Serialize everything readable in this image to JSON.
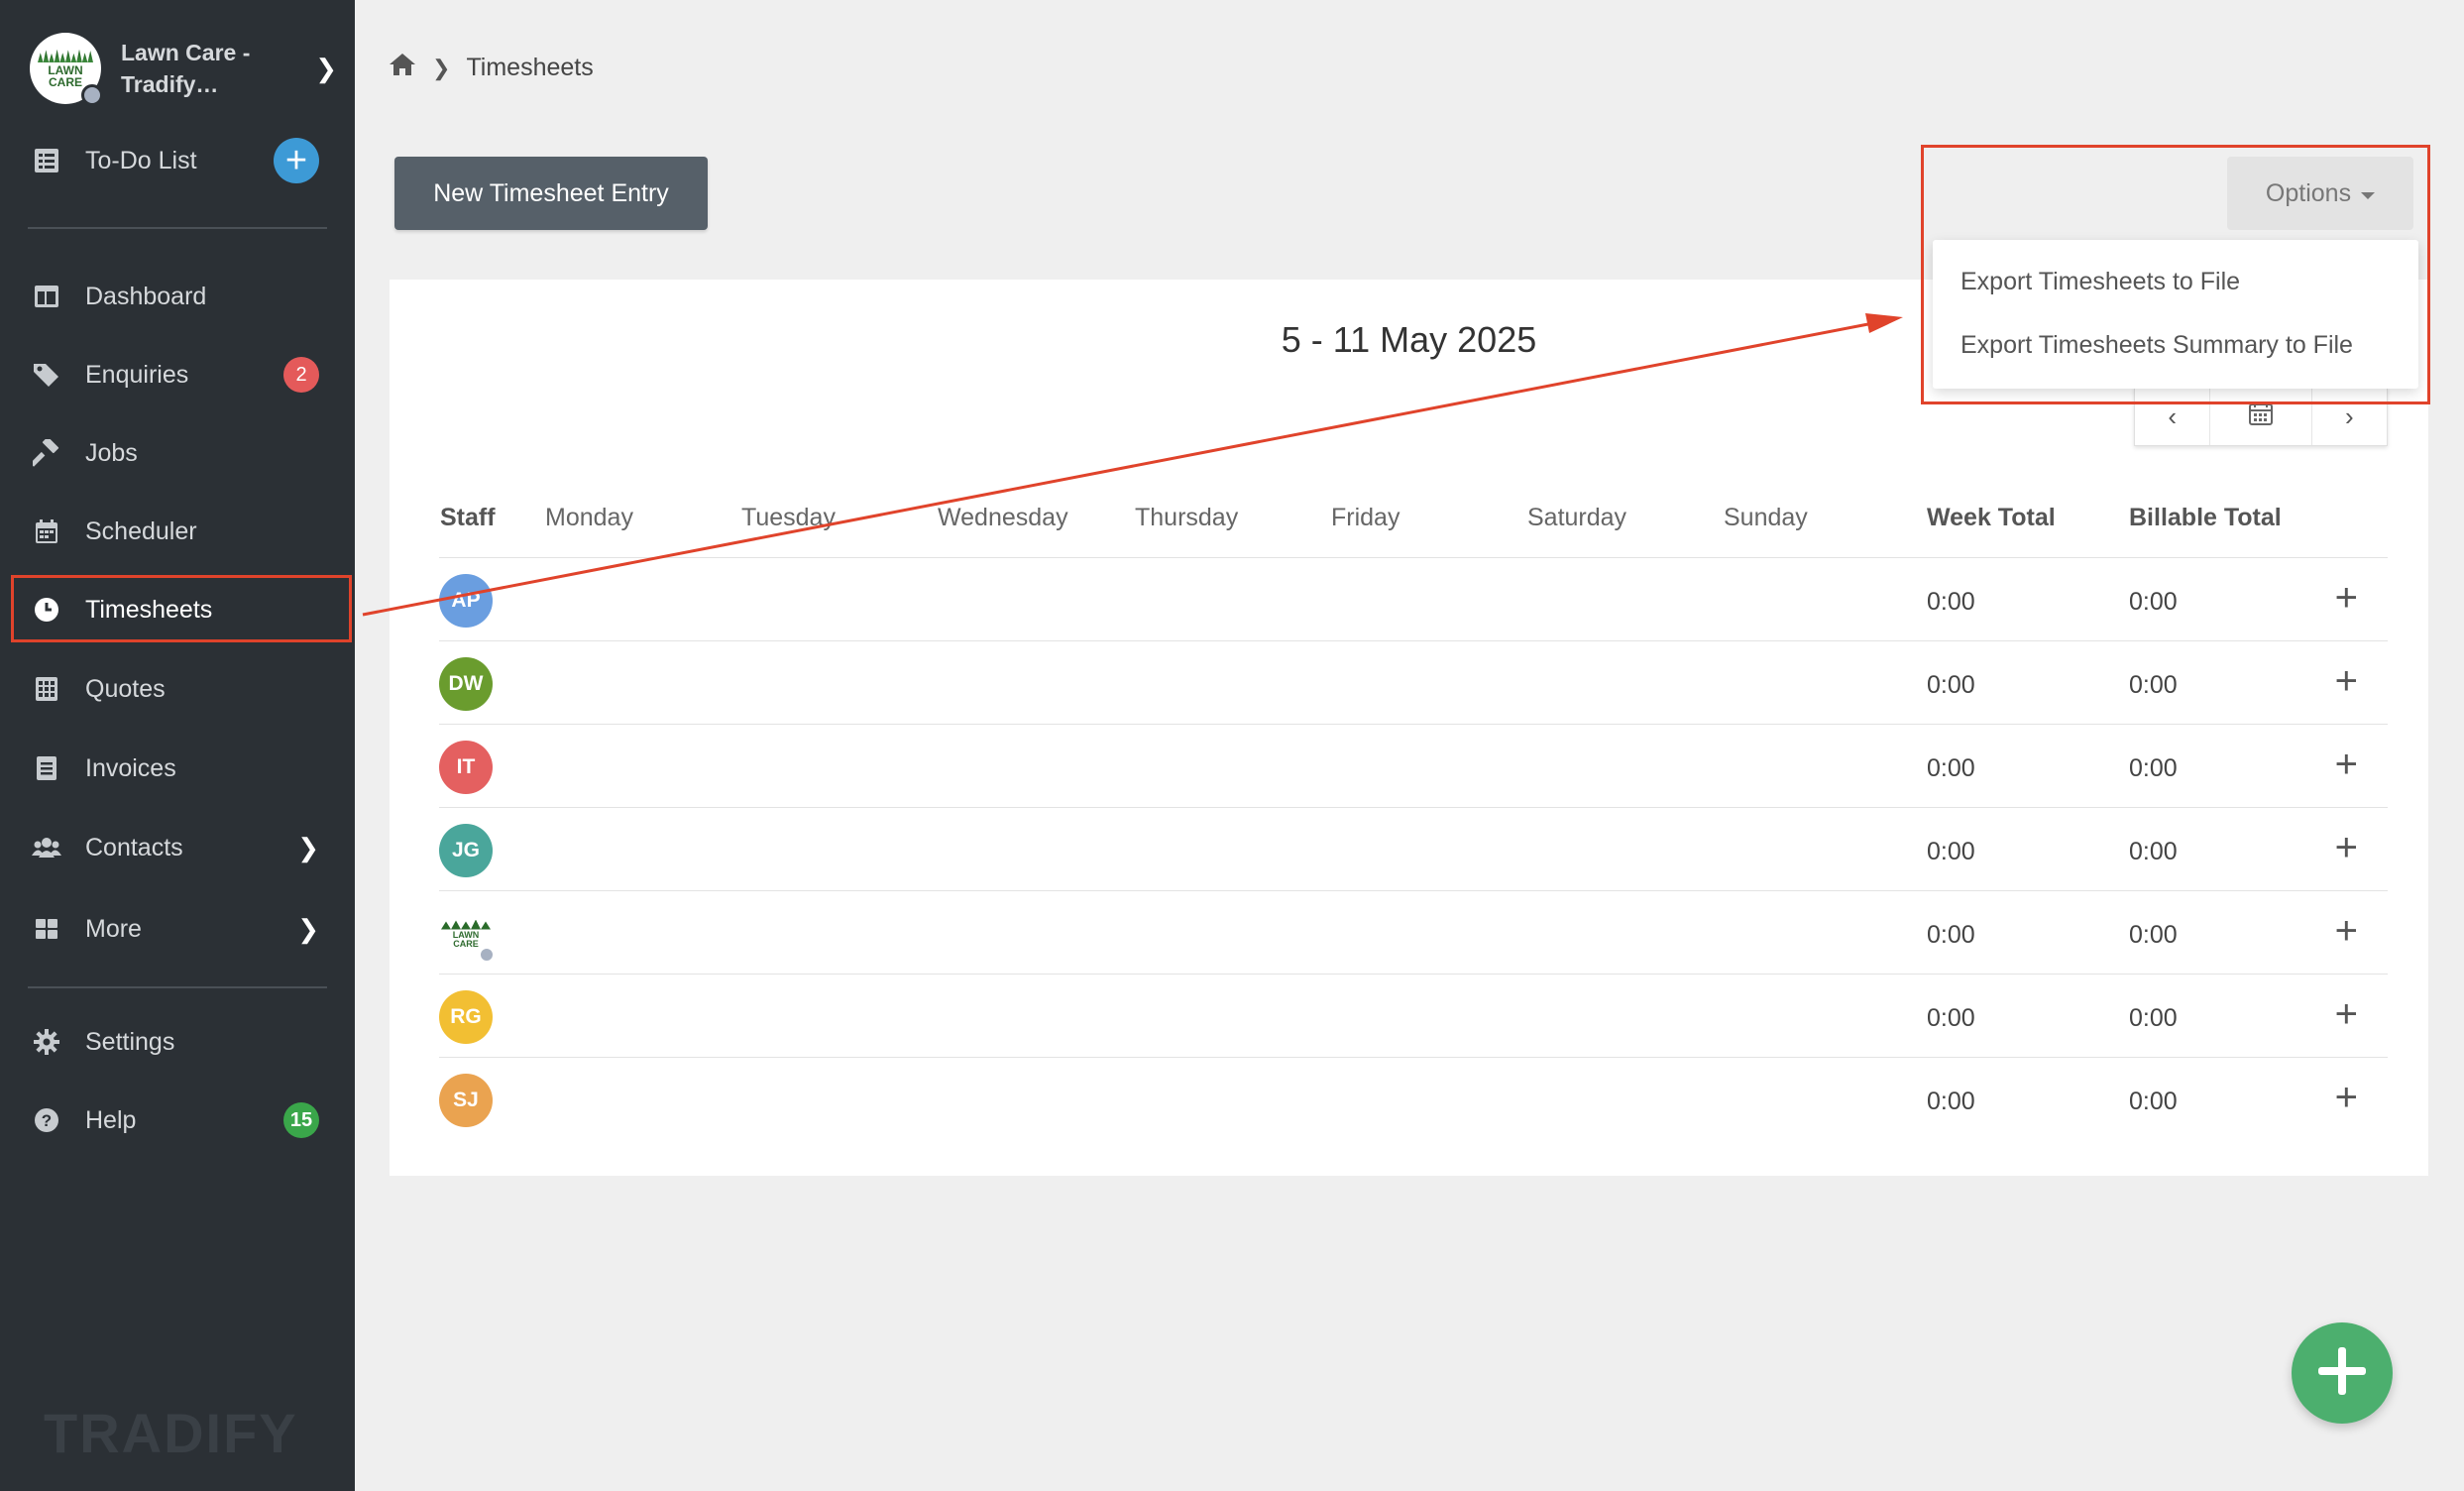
{
  "sidebar": {
    "org_name": "Lawn Care - Tradify…",
    "org_logo_text": "LAWN CARE",
    "todo_label": "To-Do List",
    "items": [
      {
        "label": "Dashboard",
        "icon": "dashboard-icon"
      },
      {
        "label": "Enquiries",
        "icon": "tags-icon",
        "badge": "2"
      },
      {
        "label": "Jobs",
        "icon": "hammer-icon"
      },
      {
        "label": "Scheduler",
        "icon": "calendar-icon"
      },
      {
        "label": "Timesheets",
        "icon": "clock-icon",
        "active": true
      },
      {
        "label": "Quotes",
        "icon": "calculator-icon"
      },
      {
        "label": "Invoices",
        "icon": "invoice-icon"
      },
      {
        "label": "Contacts",
        "icon": "users-icon"
      },
      {
        "label": "More",
        "icon": "grid-icon"
      },
      {
        "label": "Settings",
        "icon": "gear-icon"
      },
      {
        "label": "Help",
        "icon": "question-icon",
        "badge": "15"
      }
    ],
    "brand": "TRADIFY"
  },
  "breadcrumb": {
    "current": "Timesheets"
  },
  "toolbar": {
    "new_entry_label": "New Timesheet Entry",
    "options_label": "Options"
  },
  "options_menu": {
    "items": [
      "Export Timesheets to File",
      "Export Timesheets Summary to File"
    ]
  },
  "timesheet": {
    "week_title": "5 - 11 May 2025",
    "columns": [
      "Staff",
      "Monday",
      "Tuesday",
      "Wednesday",
      "Thursday",
      "Friday",
      "Saturday",
      "Sunday",
      "Week Total",
      "Billable Total"
    ],
    "rows": [
      {
        "initials": "AP",
        "color": "#6a9ee0",
        "week_total": "0:00",
        "billable_total": "0:00"
      },
      {
        "initials": "DW",
        "color": "#6a9c2e",
        "week_total": "0:00",
        "billable_total": "0:00"
      },
      {
        "initials": "IT",
        "color": "#e46060",
        "week_total": "0:00",
        "billable_total": "0:00"
      },
      {
        "initials": "JG",
        "color": "#4aa69b",
        "week_total": "0:00",
        "billable_total": "0:00"
      },
      {
        "initials": "",
        "logo": true,
        "logo_text": "LAWN CARE",
        "week_total": "0:00",
        "billable_total": "0:00"
      },
      {
        "initials": "RG",
        "color": "#f2bf33",
        "week_total": "0:00",
        "billable_total": "0:00"
      },
      {
        "initials": "SJ",
        "color": "#eaa350",
        "week_total": "0:00",
        "billable_total": "0:00"
      }
    ]
  },
  "colors": {
    "sidebar_bg": "#2b3035",
    "highlight": "#e0432b",
    "fab": "#4caf6e",
    "button_dark": "#566069"
  }
}
